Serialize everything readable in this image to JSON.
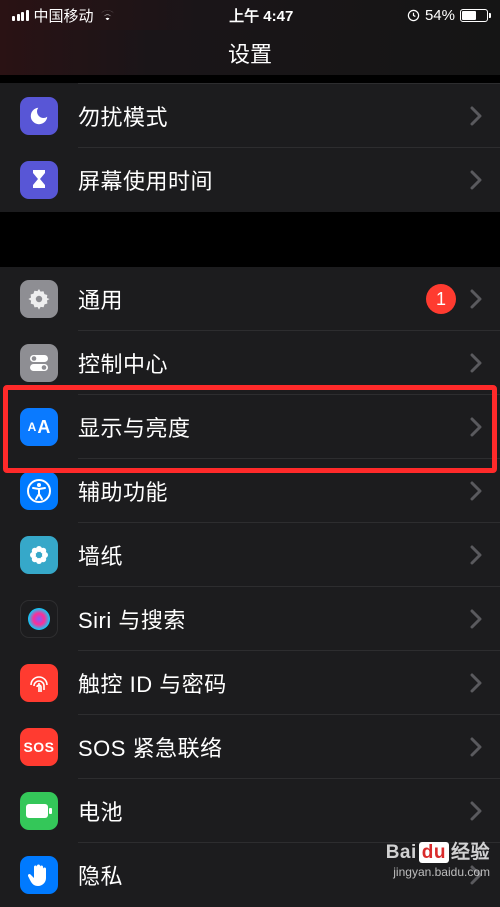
{
  "status": {
    "carrier": "中国移动",
    "time": "上午 4:47",
    "battery_pct": "54%"
  },
  "nav": {
    "title": "设置"
  },
  "group1": [
    {
      "id": "do-not-disturb",
      "label": "勿扰模式"
    },
    {
      "id": "screen-time",
      "label": "屏幕使用时间"
    }
  ],
  "group2": [
    {
      "id": "general",
      "label": "通用",
      "badge": "1"
    },
    {
      "id": "control-center",
      "label": "控制中心"
    },
    {
      "id": "display",
      "label": "显示与亮度",
      "highlighted": true
    },
    {
      "id": "accessibility",
      "label": "辅助功能"
    },
    {
      "id": "wallpaper",
      "label": "墙纸"
    },
    {
      "id": "siri",
      "label": "Siri 与搜索"
    },
    {
      "id": "touchid",
      "label": "触控 ID 与密码"
    },
    {
      "id": "sos",
      "label": "SOS 紧急联络",
      "sos_text": "SOS"
    },
    {
      "id": "battery",
      "label": "电池"
    },
    {
      "id": "privacy",
      "label": "隐私"
    }
  ],
  "watermark": {
    "line1_a": "Bai",
    "line1_b": "du",
    "line1_c": "经验",
    "line2": "jingyan.baidu.com"
  }
}
